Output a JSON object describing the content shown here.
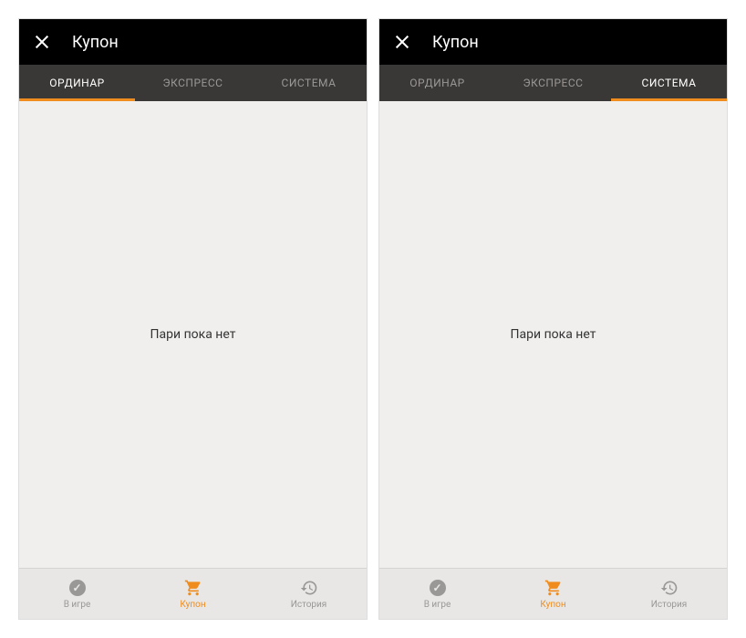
{
  "screens": [
    {
      "header": {
        "title": "Купон"
      },
      "tabs": [
        {
          "label": "ОРДИНАР",
          "active": true
        },
        {
          "label": "ЭКСПРЕСС",
          "active": false
        },
        {
          "label": "СИСТЕМА",
          "active": false
        }
      ],
      "emptyMessage": "Пари пока нет",
      "bottomNav": [
        {
          "label": "В игре",
          "icon": "inplay",
          "active": false
        },
        {
          "label": "Купон",
          "icon": "cart",
          "active": true
        },
        {
          "label": "История",
          "icon": "history",
          "active": false
        }
      ]
    },
    {
      "header": {
        "title": "Купон"
      },
      "tabs": [
        {
          "label": "ОРДИНАР",
          "active": false
        },
        {
          "label": "ЭКСПРЕСС",
          "active": false
        },
        {
          "label": "СИСТЕМА",
          "active": true
        }
      ],
      "emptyMessage": "Пари пока нет",
      "bottomNav": [
        {
          "label": "В игре",
          "icon": "inplay",
          "active": false
        },
        {
          "label": "Купон",
          "icon": "cart",
          "active": true
        },
        {
          "label": "История",
          "icon": "history",
          "active": false
        }
      ]
    }
  ]
}
